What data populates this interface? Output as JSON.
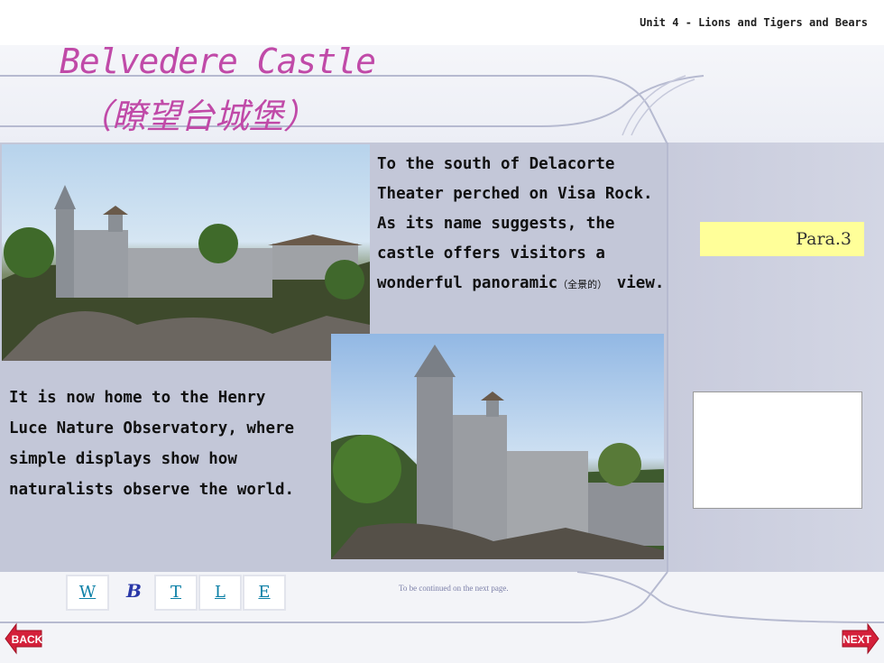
{
  "header": {
    "unit_label": "Unit 4 - Lions and Tigers and Bears"
  },
  "title": {
    "line1": "Belvedere Castle",
    "line2": "（瞭望台城堡）"
  },
  "paragraph_top": {
    "line1": "To the south of Delacorte",
    "line2": "Theater perched on Visa Rock.",
    "line3": "As its name suggests, the",
    "line4": "castle offers visitors a",
    "line5_a": "wonderful panoramic",
    "line5_note": "（全景的）",
    "line5_b": " view."
  },
  "paragraph_bottom": {
    "line1": "It is now home to the Henry",
    "line2": "Luce Nature Observatory, where",
    "line3": "simple displays show how",
    "line4": "naturalists observe the world."
  },
  "para_label": "Para.3",
  "nav": {
    "w": "W",
    "b": "B",
    "t": "T",
    "l": "L",
    "e": "E"
  },
  "continued_text": "To be continued on the next page.",
  "buttons": {
    "back": "BACK",
    "next": "NEXT"
  },
  "colors": {
    "title": "#c04aa8",
    "nav_link": "#0a7fa6",
    "arrow": "#d4203a",
    "para_box": "#ffff99"
  }
}
